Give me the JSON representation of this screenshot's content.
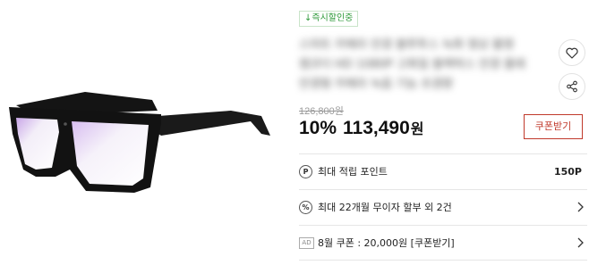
{
  "badge": {
    "label": "↓즉시할인중"
  },
  "title_blurred": [
    "스마트 카메라 안경 블루투스 녹화 영상 촬영",
    "캠코더 HD 1080P 고화질 블랙박스 안경 몰래",
    "안경형 카메라 녹음 기능 초경량"
  ],
  "actions": {
    "like_icon": "heart-icon",
    "share_icon": "share-icon"
  },
  "price": {
    "original": "126,800원",
    "discount": "10%",
    "sale": "113,490",
    "currency": "원"
  },
  "coupon_button": {
    "label": "쿠폰받기",
    "color": "#c0392b"
  },
  "benefits": [
    {
      "icon": "P",
      "label": "최대 적립 포인트",
      "value": "150P"
    },
    {
      "icon": "%",
      "label": "최대 22개월 무이자 할부 외 2건",
      "value": ""
    },
    {
      "tag": "AD",
      "label": "8월 쿠폰 : 20,000원 [쿠폰받기]",
      "value": ""
    }
  ]
}
